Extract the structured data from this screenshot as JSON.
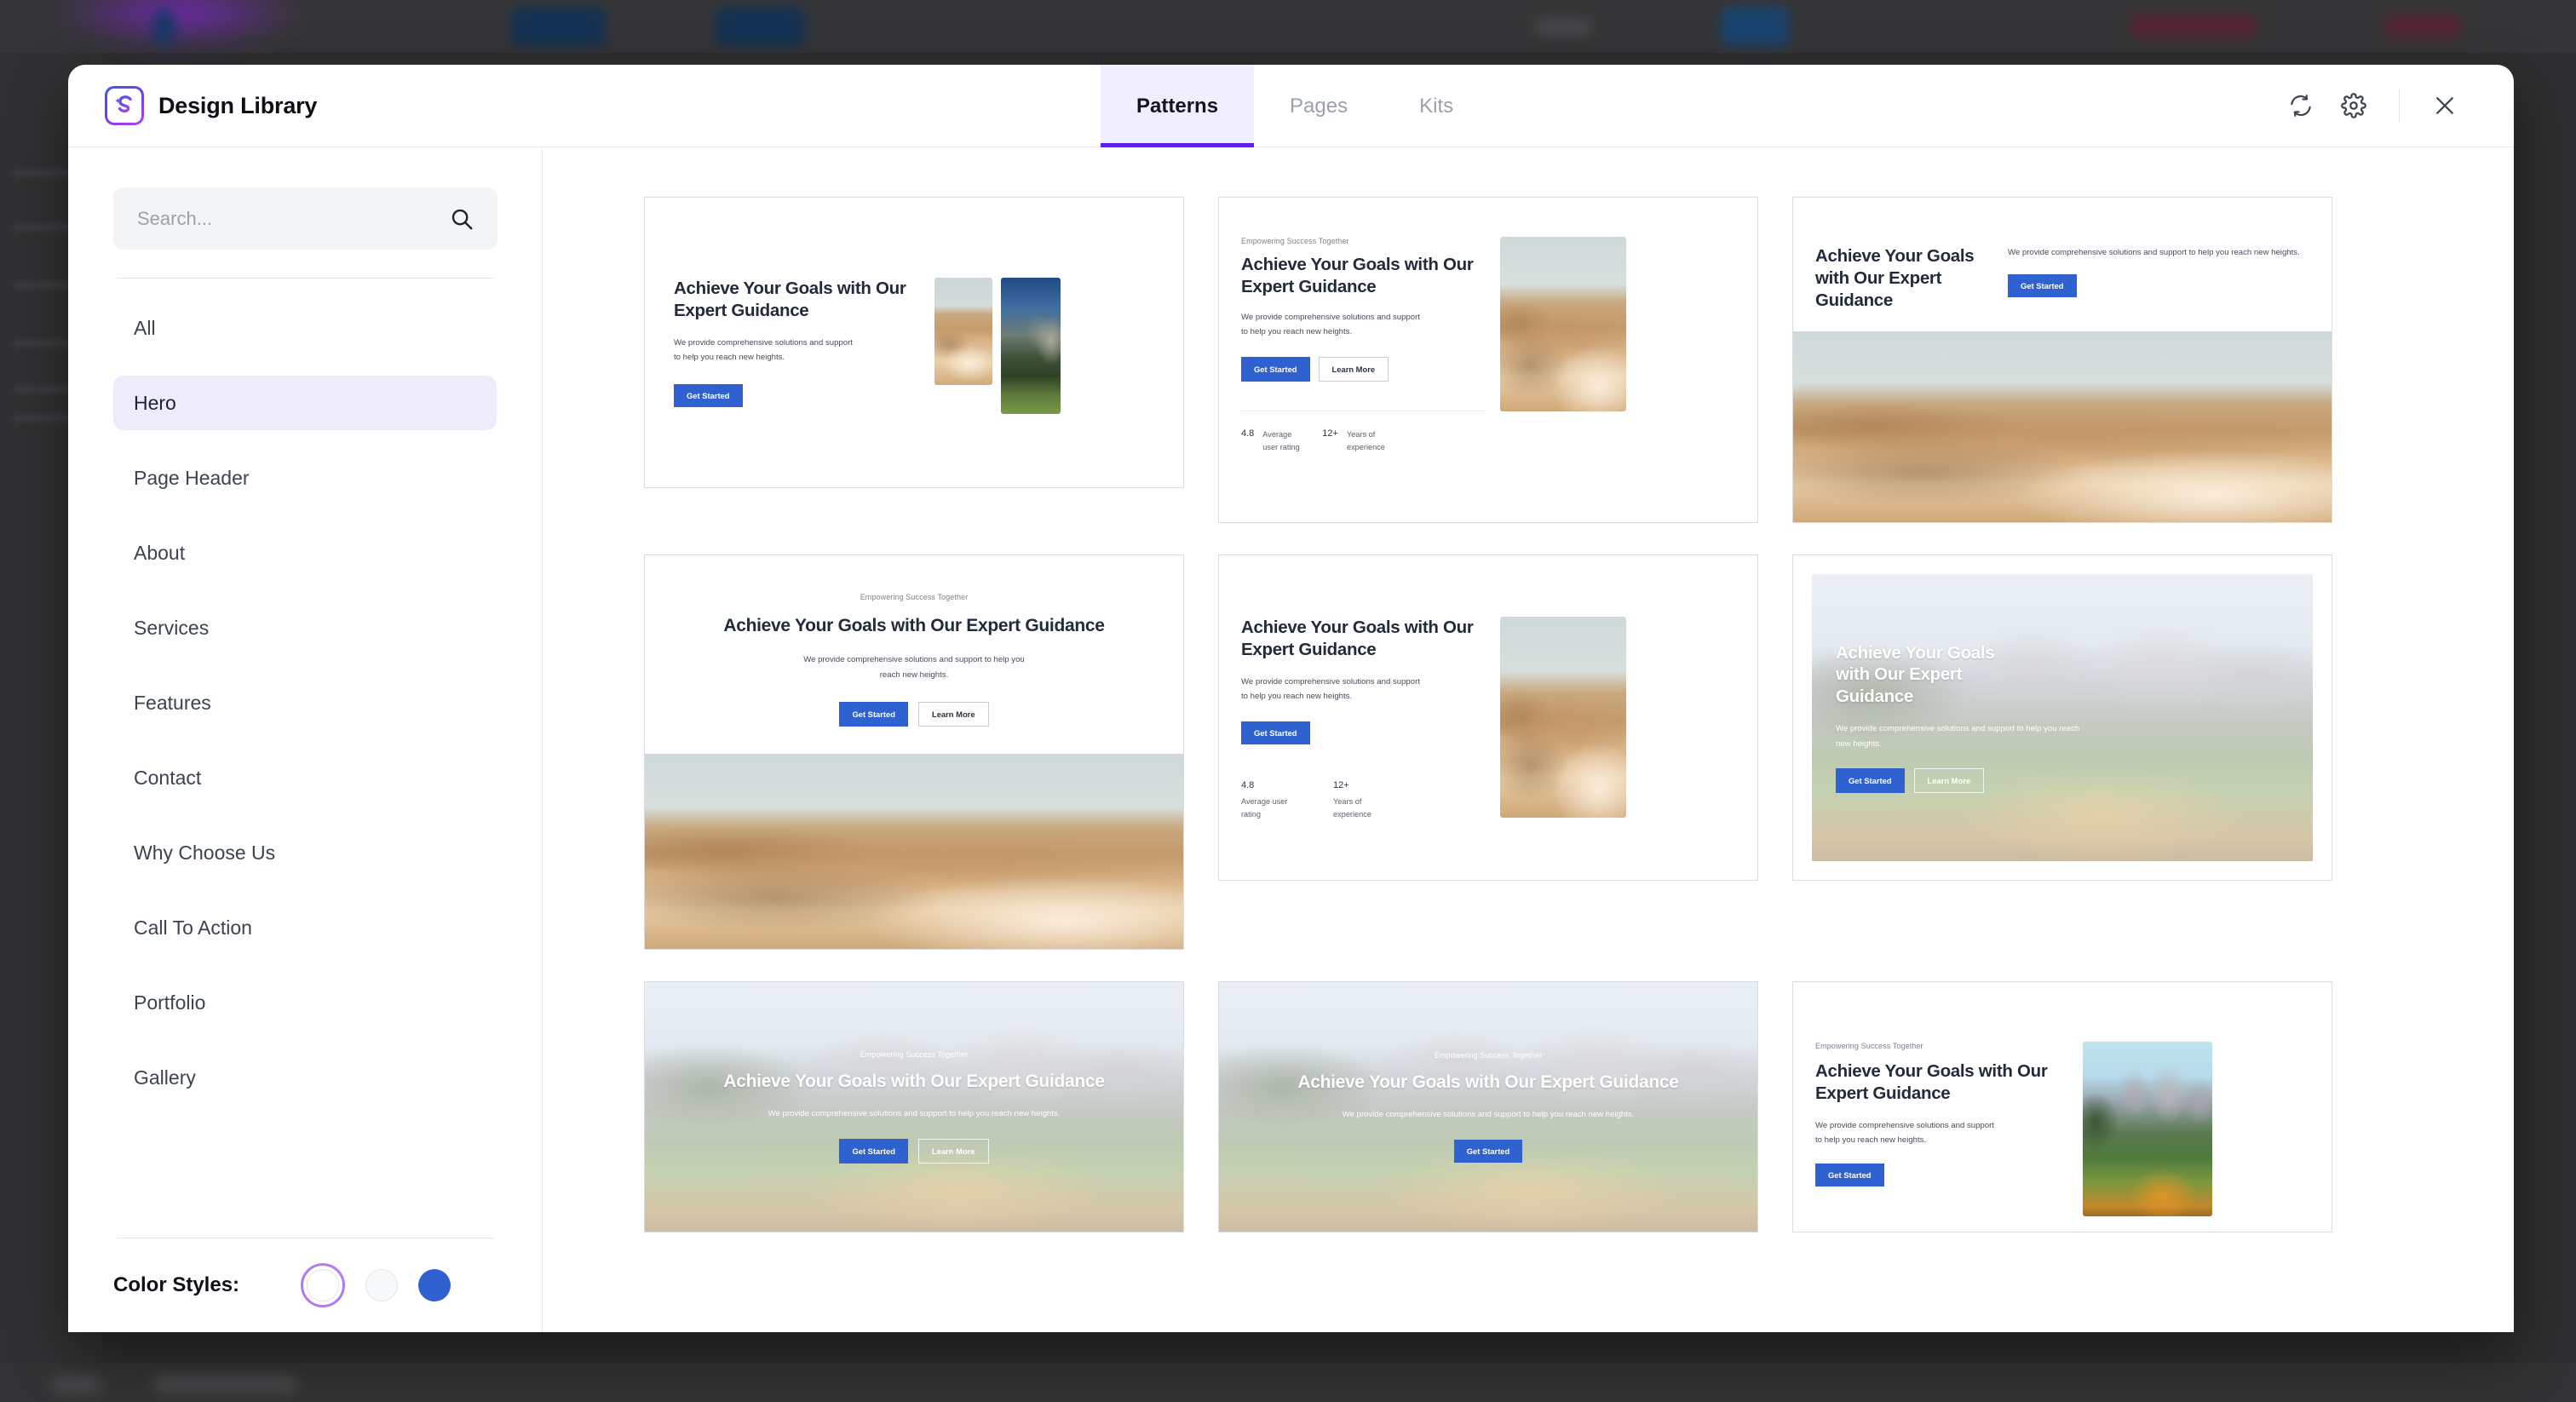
{
  "header": {
    "brand_title": "Design Library",
    "logo_glyph": "S",
    "tabs": [
      {
        "label": "Patterns",
        "active": true
      },
      {
        "label": "Pages",
        "active": false
      },
      {
        "label": "Kits",
        "active": false
      }
    ],
    "actions": [
      {
        "name": "refresh-icon"
      },
      {
        "name": "gear-icon"
      },
      {
        "name": "close-icon"
      }
    ]
  },
  "sidebar": {
    "search": {
      "placeholder": "Search...",
      "value": ""
    },
    "items": [
      {
        "label": "All",
        "active": false
      },
      {
        "label": "Hero",
        "active": true
      },
      {
        "label": "Page Header",
        "active": false
      },
      {
        "label": "About",
        "active": false
      },
      {
        "label": "Services",
        "active": false
      },
      {
        "label": "Features",
        "active": false
      },
      {
        "label": "Contact",
        "active": false
      },
      {
        "label": "Why Choose Us",
        "active": false
      },
      {
        "label": "Call To Action",
        "active": false
      },
      {
        "label": "Portfolio",
        "active": false
      },
      {
        "label": "Gallery",
        "active": false
      }
    ],
    "color_styles": {
      "label": "Color Styles:",
      "swatches": [
        {
          "name": "white",
          "hex": "#FFFFFF",
          "selected": true
        },
        {
          "name": "off-white",
          "hex": "#F7F8FA",
          "selected": false
        },
        {
          "name": "blue",
          "hex": "#2F62D0",
          "selected": false
        }
      ],
      "selection_ring_hex": "#B07CF0"
    }
  },
  "common": {
    "eyebrow": "Empowering Success Together",
    "heading": "Achieve Your Goals with Our Expert Guidance",
    "body": "We provide comprehensive solutions and support to help you reach new heights.",
    "cta_primary": "Get Started",
    "cta_secondary": "Learn More",
    "stat1_value": "4.8",
    "stat1_label": "Average user rating",
    "stat2_value": "12+",
    "stat2_label": "Years of experience",
    "accent_hex": "#2F62D0",
    "heading_hex": "#222B3B"
  },
  "patterns": [
    {
      "id": "hero-split-two-images",
      "layout": "split-right-two-images"
    },
    {
      "id": "hero-split-stats-inline",
      "layout": "split-right-image-stats-inline"
    },
    {
      "id": "hero-top-split-full-image",
      "layout": "top-split-full-width-image"
    },
    {
      "id": "hero-centered-full-image",
      "layout": "centered-text-full-width-image"
    },
    {
      "id": "hero-split-stats-stacked",
      "layout": "split-right-image-stats-stacked"
    },
    {
      "id": "hero-overlay-inset-left",
      "layout": "overlay-image-inset-left-text"
    },
    {
      "id": "hero-overlay-full-centered",
      "layout": "overlay-full-bleed-centered"
    },
    {
      "id": "hero-overlay-full-centered-single-cta",
      "layout": "overlay-full-bleed-centered-single-cta"
    },
    {
      "id": "hero-split-right-mountain",
      "layout": "split-right-mountain-image"
    }
  ]
}
